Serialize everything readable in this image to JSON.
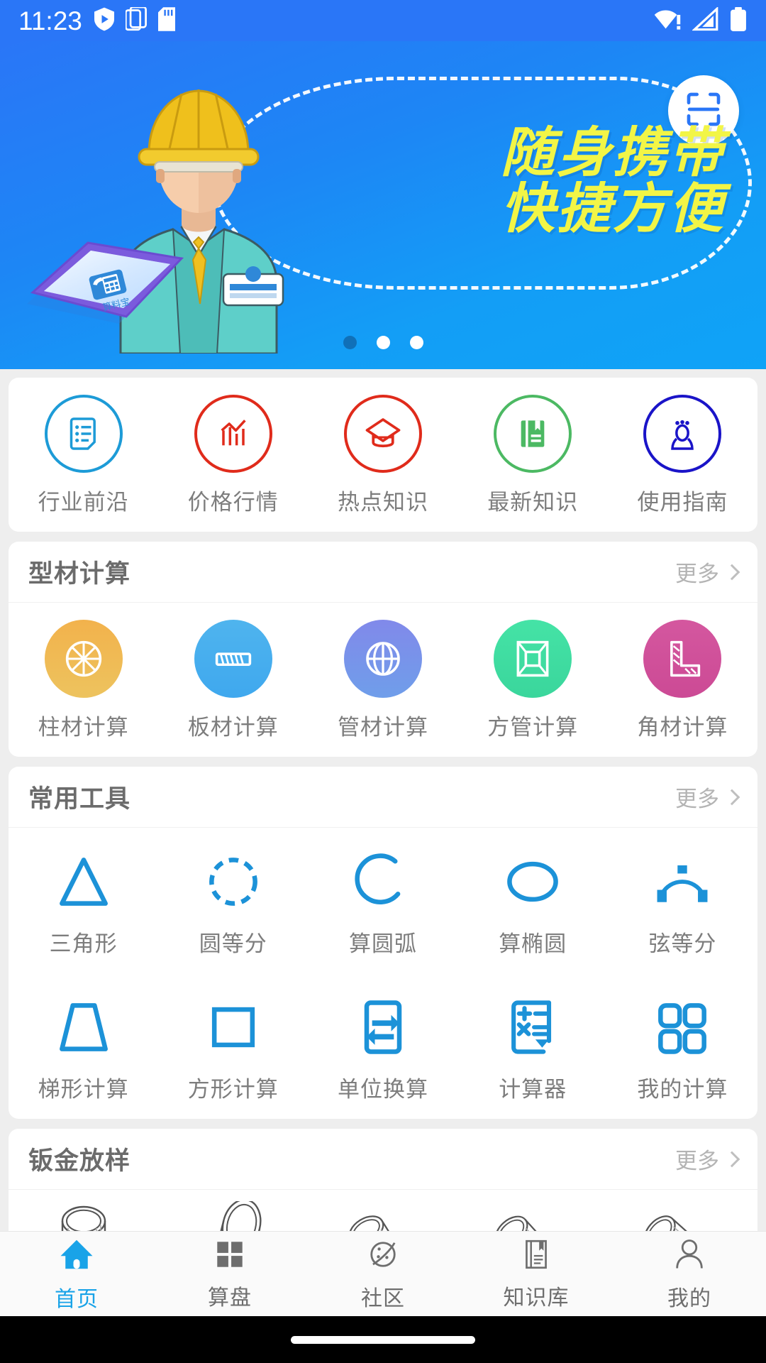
{
  "statusbar": {
    "time": "11:23",
    "left_icons": [
      "shield-play-icon",
      "multi-window-icon",
      "sd-card-icon"
    ],
    "right_icons": [
      "wifi-warning-icon",
      "cellular-signal-icon",
      "battery-icon"
    ]
  },
  "banner": {
    "title_line1": "随身携带",
    "title_line2": "快捷方便",
    "scan_icon": "scan-qr-icon",
    "phone_app_label": "算料宝",
    "dots": {
      "count": 3,
      "active_index": 0
    },
    "colors": {
      "bg_start": "#2a76f7",
      "bg_end": "#0fa3f7",
      "title": "#f2f546",
      "active_dot": "#1070b8"
    }
  },
  "quick_links": {
    "items": [
      {
        "label": "行业前沿",
        "icon": "document-list-icon",
        "color": "#1d9bd7"
      },
      {
        "label": "价格行情",
        "icon": "bar-chart-trend-icon",
        "color": "#e02b1b"
      },
      {
        "label": "热点知识",
        "icon": "graduation-cap-icon",
        "color": "#e02b1b"
      },
      {
        "label": "最新知识",
        "icon": "book-bookmark-icon",
        "color": "#4cb963"
      },
      {
        "label": "使用指南",
        "icon": "user-guide-icon",
        "color": "#1a14c8"
      }
    ]
  },
  "sections": [
    {
      "title": "型材计算",
      "more_label": "更多",
      "items": [
        {
          "label": "柱材计算",
          "icon": "round-bar-icon",
          "color": "#f0a93c"
        },
        {
          "label": "板材计算",
          "icon": "plate-icon",
          "color": "#4fb4ee"
        },
        {
          "label": "管材计算",
          "icon": "pipe-icon",
          "color": "#7b86e8"
        },
        {
          "label": "方管计算",
          "icon": "square-tube-icon",
          "color": "#40dfa0"
        },
        {
          "label": "角材计算",
          "icon": "angle-bar-icon",
          "color": "#d0539b"
        }
      ]
    },
    {
      "title": "常用工具",
      "more_label": "更多",
      "items": [
        {
          "label": "三角形",
          "icon": "triangle-icon",
          "color": "#1c92d8"
        },
        {
          "label": "圆等分",
          "icon": "dashed-circle-icon",
          "color": "#1c92d8"
        },
        {
          "label": "算圆弧",
          "icon": "arc-icon",
          "color": "#1c92d8"
        },
        {
          "label": "算椭圆",
          "icon": "ellipse-icon",
          "color": "#1c92d8"
        },
        {
          "label": "弦等分",
          "icon": "chord-divide-icon",
          "color": "#1c92d8"
        },
        {
          "label": "梯形计算",
          "icon": "trapezoid-icon",
          "color": "#1c92d8"
        },
        {
          "label": "方形计算",
          "icon": "rectangle-icon",
          "color": "#1c92d8"
        },
        {
          "label": "单位换算",
          "icon": "unit-convert-icon",
          "color": "#1c92d8"
        },
        {
          "label": "计算器",
          "icon": "calculator-icon",
          "color": "#1c92d8"
        },
        {
          "label": "我的计算",
          "icon": "grid-four-icon",
          "color": "#1c92d8"
        }
      ]
    },
    {
      "title": "钣金放样",
      "more_label": "更多",
      "items": [
        {
          "label": "",
          "icon": "straight-pipe-icon"
        },
        {
          "label": "",
          "icon": "angled-cut-pipe-icon"
        },
        {
          "label": "",
          "icon": "elbow-pipe-30-icon"
        },
        {
          "label": "",
          "icon": "elbow-pipe-45-icon"
        },
        {
          "label": "",
          "icon": "elbow-pipe-60-icon"
        }
      ]
    }
  ],
  "tabbar": {
    "items": [
      {
        "label": "首页",
        "icon": "home-icon",
        "active": true
      },
      {
        "label": "算盘",
        "icon": "grid-squares-icon",
        "active": false
      },
      {
        "label": "社区",
        "icon": "community-planet-icon",
        "active": false
      },
      {
        "label": "知识库",
        "icon": "knowledge-book-icon",
        "active": false
      },
      {
        "label": "我的",
        "icon": "person-icon",
        "active": false
      }
    ],
    "active_color": "#19a3e8",
    "inactive_color": "#6e6e6e"
  }
}
